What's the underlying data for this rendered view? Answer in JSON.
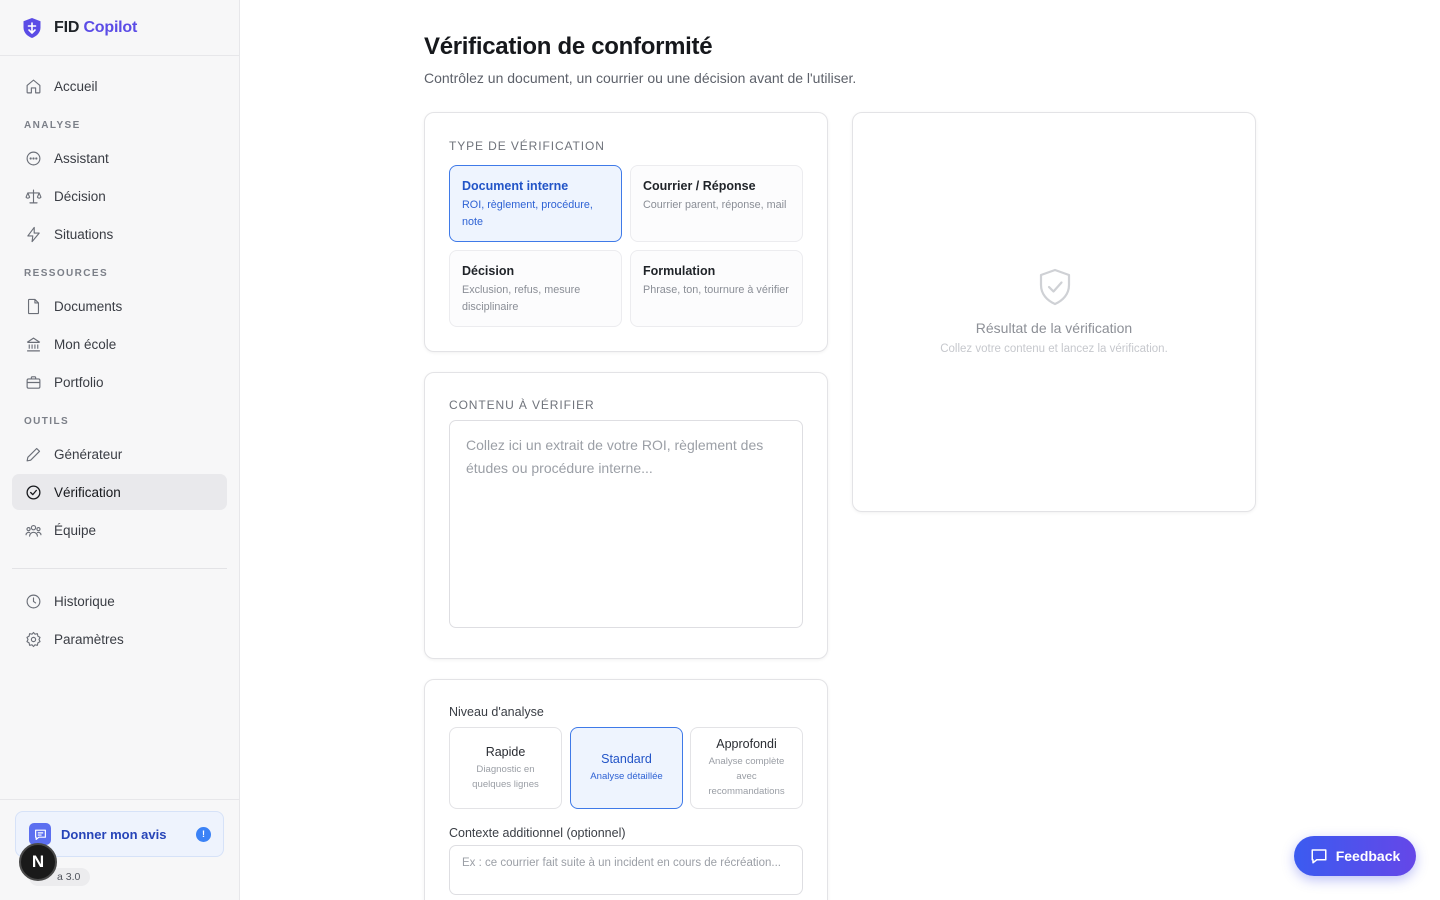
{
  "brand": {
    "name_part1": "FID",
    "name_part2": "Copilot"
  },
  "sidebar": {
    "home": "Accueil",
    "sections": [
      {
        "title": "ANALYSE",
        "items": [
          "Assistant",
          "Décision",
          "Situations"
        ]
      },
      {
        "title": "RESSOURCES",
        "items": [
          "Documents",
          "Mon école",
          "Portfolio"
        ]
      },
      {
        "title": "OUTILS",
        "items": [
          "Générateur",
          "Vérification",
          "Équipe"
        ]
      }
    ],
    "bottom_items": [
      "Historique",
      "Paramètres"
    ],
    "active": "Vérification",
    "feedback_card": {
      "label": "Donner mon avis",
      "badge": "!"
    },
    "version": "a 3.0",
    "n_badge": "N"
  },
  "page": {
    "title": "Vérification de conformité",
    "subtitle": "Contrôlez un document, un courrier ou une décision avant de l'utiliser."
  },
  "type_card": {
    "title": "TYPE DE VÉRIFICATION",
    "options": [
      {
        "title": "Document interne",
        "desc": "ROI, règlement, procédure, note",
        "selected": true
      },
      {
        "title": "Courrier / Réponse",
        "desc": "Courrier parent, réponse, mail",
        "selected": false
      },
      {
        "title": "Décision",
        "desc": "Exclusion, refus, mesure disciplinaire",
        "selected": false
      },
      {
        "title": "Formulation",
        "desc": "Phrase, ton, tournure à vérifier",
        "selected": false
      }
    ]
  },
  "content_card": {
    "title": "CONTENU À VÉRIFIER",
    "placeholder": "Collez ici un extrait de votre ROI, règlement des études ou procédure interne..."
  },
  "level_card": {
    "label": "Niveau d'analyse",
    "levels": [
      {
        "title": "Rapide",
        "desc": "Diagnostic en quelques lignes",
        "selected": false
      },
      {
        "title": "Standard",
        "desc": "Analyse détaillée",
        "selected": true
      },
      {
        "title": "Approfondi",
        "desc": "Analyse complète avec recommandations",
        "selected": false
      }
    ],
    "context_label": "Contexte additionnel (optionnel)",
    "context_placeholder": "Ex : ce courrier fait suite à un incident en cours de récréation..."
  },
  "result": {
    "title": "Résultat de la vérification",
    "subtitle": "Collez votre contenu et lancez la vérification."
  },
  "feedback_button": {
    "label": "Feedback"
  },
  "colors": {
    "accent": "#3f7ae8",
    "brand": "#5b4ce6",
    "active_bg": "#e9e9ec"
  }
}
